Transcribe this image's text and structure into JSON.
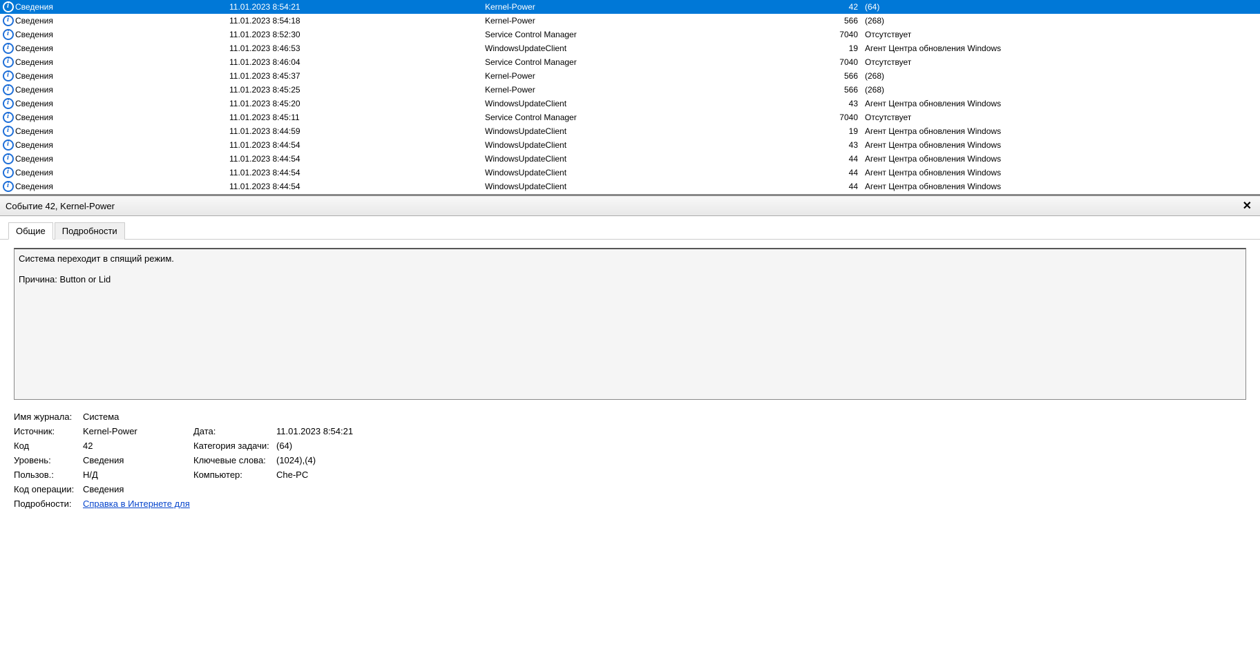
{
  "events": [
    {
      "level": "Сведения",
      "date": "11.01.2023 8:54:21",
      "source": "Kernel-Power",
      "id": "42",
      "task": "(64)",
      "selected": true
    },
    {
      "level": "Сведения",
      "date": "11.01.2023 8:54:18",
      "source": "Kernel-Power",
      "id": "566",
      "task": "(268)"
    },
    {
      "level": "Сведения",
      "date": "11.01.2023 8:52:30",
      "source": "Service Control Manager",
      "id": "7040",
      "task": "Отсутствует"
    },
    {
      "level": "Сведения",
      "date": "11.01.2023 8:46:53",
      "source": "WindowsUpdateClient",
      "id": "19",
      "task": "Агент Центра обновления Windows"
    },
    {
      "level": "Сведения",
      "date": "11.01.2023 8:46:04",
      "source": "Service Control Manager",
      "id": "7040",
      "task": "Отсутствует"
    },
    {
      "level": "Сведения",
      "date": "11.01.2023 8:45:37",
      "source": "Kernel-Power",
      "id": "566",
      "task": "(268)"
    },
    {
      "level": "Сведения",
      "date": "11.01.2023 8:45:25",
      "source": "Kernel-Power",
      "id": "566",
      "task": "(268)"
    },
    {
      "level": "Сведения",
      "date": "11.01.2023 8:45:20",
      "source": "WindowsUpdateClient",
      "id": "43",
      "task": "Агент Центра обновления Windows"
    },
    {
      "level": "Сведения",
      "date": "11.01.2023 8:45:11",
      "source": "Service Control Manager",
      "id": "7040",
      "task": "Отсутствует"
    },
    {
      "level": "Сведения",
      "date": "11.01.2023 8:44:59",
      "source": "WindowsUpdateClient",
      "id": "19",
      "task": "Агент Центра обновления Windows"
    },
    {
      "level": "Сведения",
      "date": "11.01.2023 8:44:54",
      "source": "WindowsUpdateClient",
      "id": "43",
      "task": "Агент Центра обновления Windows"
    },
    {
      "level": "Сведения",
      "date": "11.01.2023 8:44:54",
      "source": "WindowsUpdateClient",
      "id": "44",
      "task": "Агент Центра обновления Windows"
    },
    {
      "level": "Сведения",
      "date": "11.01.2023 8:44:54",
      "source": "WindowsUpdateClient",
      "id": "44",
      "task": "Агент Центра обновления Windows"
    },
    {
      "level": "Сведения",
      "date": "11.01.2023 8:44:54",
      "source": "WindowsUpdateClient",
      "id": "44",
      "task": "Агент Центра обновления Windows"
    }
  ],
  "detail": {
    "header": "Событие 42, Kernel-Power",
    "tabs": {
      "general": "Общие",
      "details": "Подробности"
    },
    "message": "Система переходит в спящий режим.\n\nПричина: Button or Lid",
    "labels": {
      "logName": "Имя журнала:",
      "source": "Источник:",
      "eventId": "Код",
      "level": "Уровень:",
      "user": "Пользов.:",
      "opcode": "Код операции:",
      "moreInfo": "Подробности:",
      "date": "Дата:",
      "taskCategory": "Категория задачи:",
      "keywords": "Ключевые слова:",
      "computer": "Компьютер:"
    },
    "values": {
      "logName": "Система",
      "source": "Kernel-Power",
      "eventId": "42",
      "level": "Сведения",
      "user": "Н/Д",
      "opcode": "Сведения",
      "moreInfoLink": "Справка в Интернете для",
      "date": "11.01.2023 8:54:21",
      "taskCategory": "(64)",
      "keywords": "(1024),(4)",
      "computer": "Che-PC"
    }
  }
}
